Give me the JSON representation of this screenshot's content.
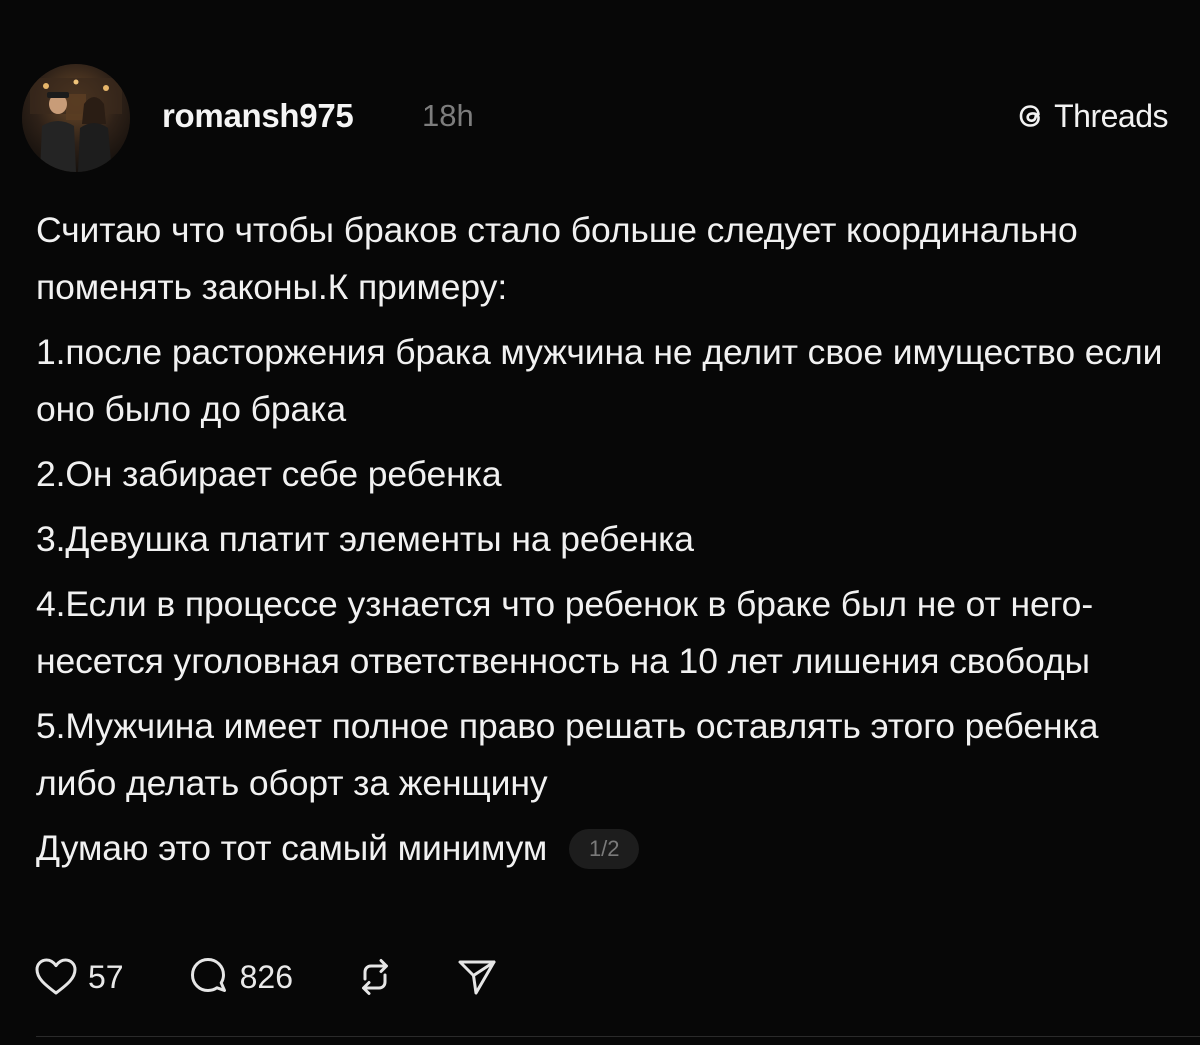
{
  "post": {
    "username": "romansh975",
    "timestamp": "18h",
    "brand": "Threads",
    "paragraphs": [
      "Считаю что чтобы браков стало больше следует координально поменять законы.К примеру:",
      "1.после расторжения брака мужчина не делит свое имущество если оно было до брака",
      "2.Он забирает себе ребенка",
      "3.Девушка платит элементы на ребенка",
      "4.Если в процессе узнается что ребенок в браке был не от него-несется уголовная ответственность на 10 лет лишения свободы",
      "5.Мужчина имеет полное право решать оставлять этого ребенка либо делать оборт за женщину"
    ],
    "last_line": "Думаю это тот самый минимум",
    "page_indicator": "1/2"
  },
  "actions": {
    "likes": "57",
    "replies": "826"
  },
  "icons": {
    "avatar": "profile-photo",
    "brand": "threads-logo-icon",
    "like": "heart-icon",
    "reply": "speech-bubble-icon",
    "repost": "repost-icon",
    "share": "send-icon"
  },
  "colors": {
    "background": "#070707",
    "text": "#f1f1f1",
    "muted": "#7d7d7d"
  }
}
